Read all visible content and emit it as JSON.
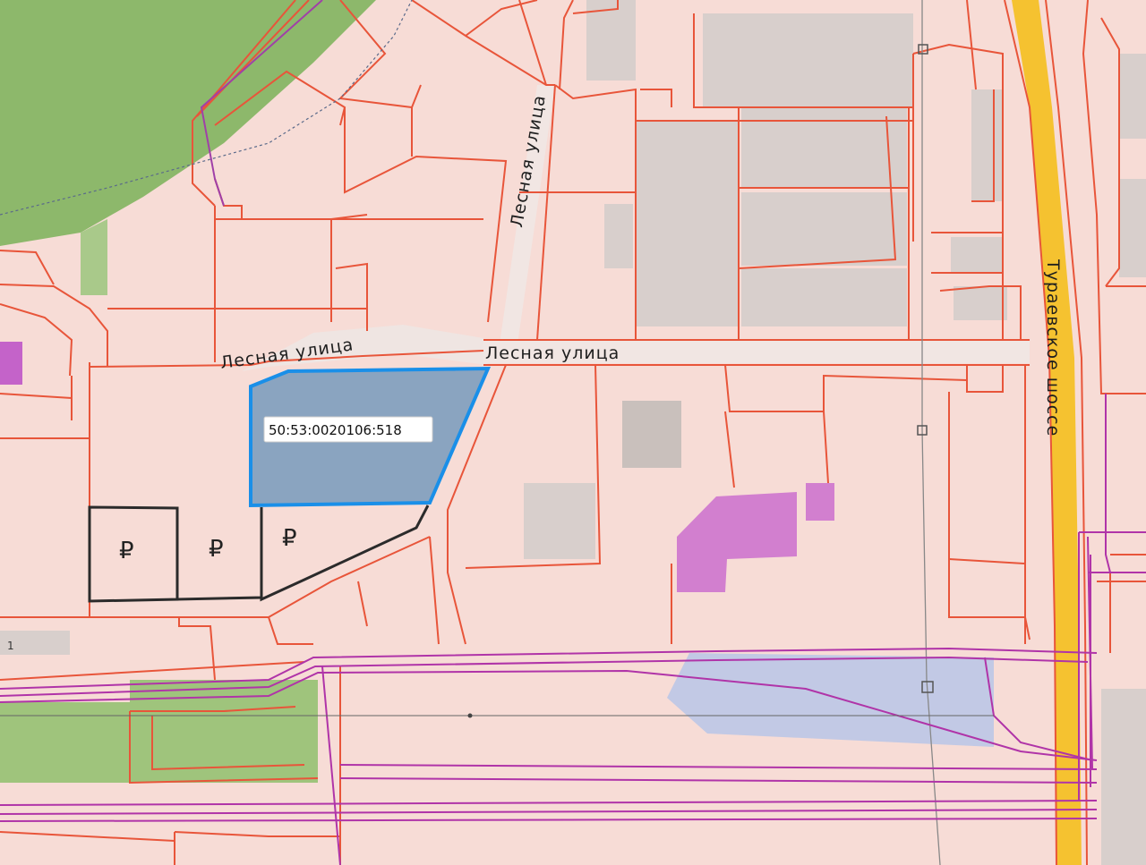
{
  "map": {
    "streets": {
      "lesnaya_west": "Лесная улица",
      "lesnaya_east": "Лесная улица",
      "lesnaya_vertical": "Лесная улица",
      "turaevskoe": "Тураевское шоссе"
    },
    "selected_parcel": {
      "cadastral_number": "50:53:0020106:518"
    },
    "paid_parking_symbol": "₽",
    "parcel_number_label": "1",
    "colors": {
      "background": "#f7dcd6",
      "parcel_border": "#e8553a",
      "selected_fill": "#8aa4c0",
      "selected_border": "#1a8fe8",
      "building": "#d8cfcc",
      "green_area": "#8db86b",
      "utility_line": "#b034a8",
      "highway": "#f5c230",
      "magenta_building": "#d27fcf",
      "parking_border": "#2b2b2b"
    }
  }
}
